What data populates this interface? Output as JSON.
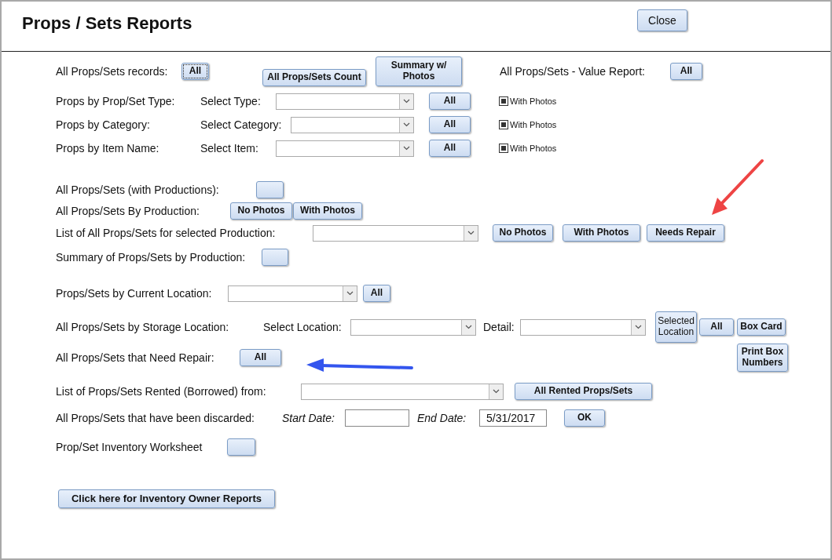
{
  "title": "Props / Sets Reports",
  "close_button": "Close",
  "rows": [
    {
      "items": [
        {
          "kind": "label",
          "text": "All Props/Sets records:"
        },
        {
          "kind": "button",
          "label": "All",
          "focused": true
        },
        {
          "kind": "button",
          "label": "All Props/Sets Count",
          "focused": false
        },
        {
          "kind": "button",
          "label": "Summary w/ Photos",
          "focused": false
        },
        {
          "kind": "label",
          "text": "All Props/Sets - Value Report:"
        },
        {
          "kind": "button",
          "label": "All",
          "focused": false
        }
      ]
    },
    {
      "items": [
        {
          "kind": "label",
          "text": "Props by Prop/Set Type:"
        },
        {
          "kind": "label",
          "text": "Select Type:"
        },
        {
          "kind": "dropdown"
        },
        {
          "kind": "button",
          "label": "All",
          "focused": false
        },
        {
          "kind": "checkbox",
          "label": "With Photos",
          "checked": true
        }
      ]
    },
    {
      "items": [
        {
          "kind": "label",
          "text": "Props by Category:"
        },
        {
          "kind": "label",
          "text": "Select Category:"
        },
        {
          "kind": "dropdown"
        },
        {
          "kind": "button",
          "label": "All",
          "focused": false
        },
        {
          "kind": "checkbox",
          "label": "With Photos",
          "checked": true
        }
      ]
    },
    {
      "items": [
        {
          "kind": "label",
          "text": "Props by Item Name:"
        },
        {
          "kind": "label",
          "text": "Select Item:"
        },
        {
          "kind": "dropdown"
        },
        {
          "kind": "button",
          "label": "All",
          "focused": false
        },
        {
          "kind": "checkbox",
          "label": "With Photos",
          "checked": true
        }
      ]
    },
    {
      "items": [
        {
          "kind": "label",
          "text": "All Props/Sets (with Productions):"
        },
        {
          "kind": "button",
          "focused": false
        }
      ]
    },
    {
      "items": [
        {
          "kind": "label",
          "text": "All Props/Sets By Production:"
        },
        {
          "kind": "button",
          "label": "No Photos",
          "focused": false
        },
        {
          "kind": "button",
          "label": "With Photos",
          "focused": false
        }
      ]
    },
    {
      "items": [
        {
          "kind": "label",
          "text": "List of All Props/Sets for selected Production:"
        },
        {
          "kind": "dropdown"
        },
        {
          "kind": "button",
          "label": "No Photos",
          "focused": false
        },
        {
          "kind": "button",
          "label": "With Photos",
          "focused": false
        },
        {
          "kind": "button",
          "label": "Needs Repair",
          "focused": false
        }
      ]
    },
    {
      "items": [
        {
          "kind": "label",
          "text": "Summary of Props/Sets by Production:"
        },
        {
          "kind": "button",
          "focused": false
        }
      ]
    },
    {
      "items": [
        {
          "kind": "label",
          "text": "Props/Sets by Current Location:"
        },
        {
          "kind": "dropdown"
        },
        {
          "kind": "button",
          "label": "All",
          "focused": false
        }
      ]
    },
    {
      "items": [
        {
          "kind": "label",
          "text": "All Props/Sets by Storage Location:"
        },
        {
          "kind": "label",
          "text": "Select Location:"
        },
        {
          "kind": "dropdown"
        },
        {
          "kind": "label",
          "text": "Detail:"
        },
        {
          "kind": "dropdown"
        },
        {
          "kind": "button",
          "label": "Selected Location",
          "focused": false
        },
        {
          "kind": "button",
          "label": "All",
          "focused": false
        },
        {
          "kind": "button",
          "label": "Box Card",
          "focused": false
        }
      ]
    },
    {
      "items": [
        {
          "kind": "label",
          "text": "All Props/Sets that Need Repair:"
        },
        {
          "kind": "button",
          "label": "All",
          "focused": false
        },
        {
          "kind": "button",
          "label": "Print Box Numbers",
          "focused": false
        }
      ]
    },
    {
      "items": [
        {
          "kind": "label",
          "text": "List of Props/Sets Rented (Borrowed) from:"
        },
        {
          "kind": "dropdown"
        },
        {
          "kind": "button",
          "label": "All Rented Props/Sets",
          "focused": false
        }
      ]
    },
    {
      "items": [
        {
          "kind": "label",
          "text": "All Props/Sets that have been discarded:"
        },
        {
          "kind": "caption",
          "text": "Start Date:"
        },
        {
          "kind": "field"
        },
        {
          "kind": "caption",
          "text": "End Date:"
        },
        {
          "kind": "field",
          "value": "5/31/2017"
        },
        {
          "kind": "button",
          "label": "OK",
          "focused": false
        }
      ]
    },
    {
      "items": [
        {
          "kind": "label",
          "text": "Prop/Set Inventory Worksheet"
        },
        {
          "kind": "button",
          "focused": false
        }
      ]
    },
    {
      "items": [
        {
          "kind": "button",
          "label": "Click here for Inventory Owner Reports",
          "focused": false
        }
      ]
    }
  ]
}
